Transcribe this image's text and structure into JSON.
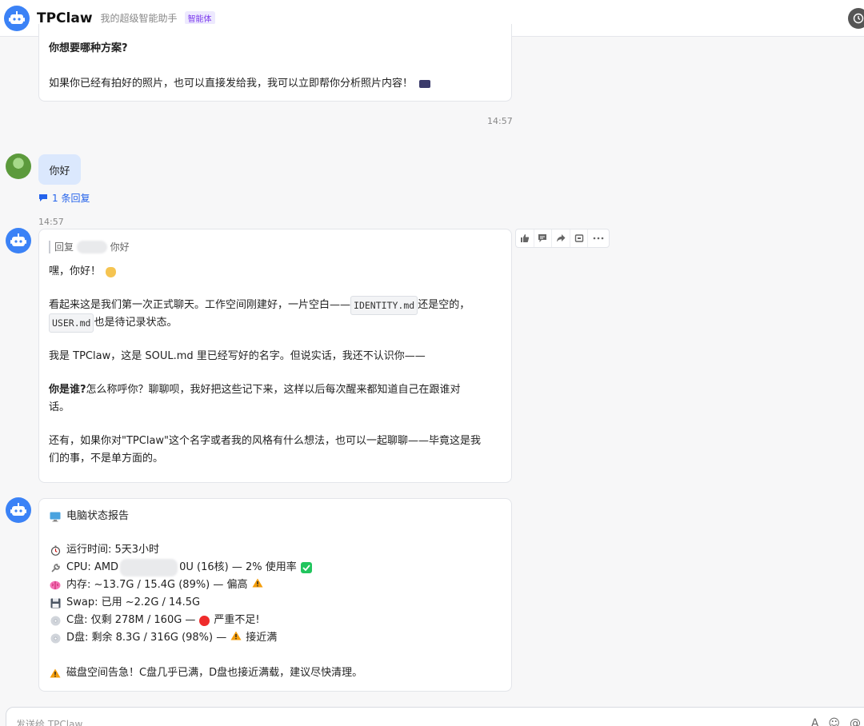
{
  "header": {
    "title": "TPClaw",
    "subtitle": "我的超级智能助手",
    "badge": "智能体"
  },
  "messages": {
    "prev": {
      "heading": "你想要哪种方案?",
      "text": "如果你已经有拍好的照片，也可以直接发给我，我可以立即帮你分析照片内容！",
      "time": "14:57"
    },
    "user": {
      "text": "你好",
      "reply_count": "1 条回复",
      "time": "14:57"
    },
    "reply": {
      "quote_prefix": "回复",
      "quote_suffix": "你好",
      "greeting": "嘿，你好！",
      "p2_a": "看起来这是我们第一次正式聊天。工作空间刚建好，一片空白——",
      "p2_code1": "IDENTITY.md",
      "p2_b": " 还是空的，",
      "p2_code2": "USER.md",
      "p2_c": " 也是待记录状态。",
      "p3": "我是 TPClaw，这是 SOUL.md 里已经写好的名字。但说实话，我还不认识你——",
      "p4_bold": "你是谁?",
      "p4_line1": "  怎么称呼你？聊聊呗，我好把这些记下来，这样以后每次醒来都知道自己在跟谁对",
      "p4_line2": "话。",
      "p5_line1": "还有，如果你对\"TPClaw\"这个名字或者我的风格有什么想法，也可以一起聊聊——毕竟这是我",
      "p5_line2": "们的事，不是单方面的。"
    },
    "status": {
      "title": "电脑状态报告",
      "uptime": "运行时间: 5天3小时",
      "cpu_prefix": "CPU: AMD",
      "cpu_suffix": "0U (16核) — 2% 使用率",
      "mem": "内存: ~13.7G / 15.4G (89%) — 偏高",
      "swap": "Swap: 已用 ~2.2G / 14.5G",
      "c_drive_a": "C盘: 仅剩 278M / 160G —",
      "c_drive_b": "严重不足!",
      "d_drive_a": "D盘: 剩余 8.3G / 316G (98%) —",
      "d_drive_b": "接近满",
      "warning": "磁盘空间告急！C盘几乎已满，D盘也接近满载，建议尽快清理。"
    }
  },
  "composer": {
    "placeholder": "发送给 TPClaw"
  },
  "colors": {
    "accent": "#3b82f6",
    "user_bubble": "#dbe8fd",
    "link": "#2563eb",
    "badge": "#7c3aed"
  }
}
